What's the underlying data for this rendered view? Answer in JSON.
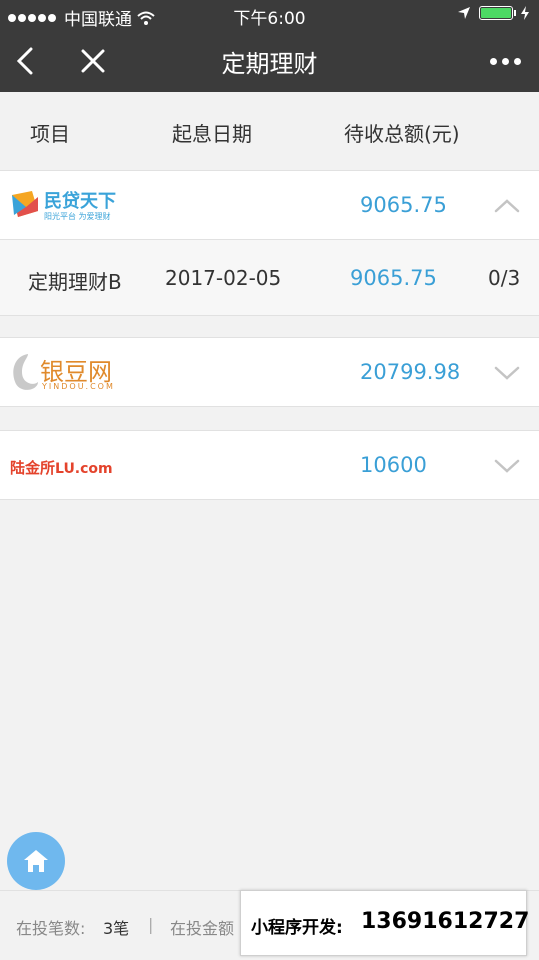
{
  "status_bar": {
    "carrier": "中国联通",
    "time": "下午6:00"
  },
  "nav": {
    "title": "定期理财"
  },
  "table_header": {
    "col1": "项目",
    "col2": "起息日期",
    "col3": "待收总额(元)"
  },
  "platforms": [
    {
      "logo_main": "民贷天下",
      "logo_sub": "阳光平台  为爱理财",
      "amount": "9065.75",
      "expanded": true
    },
    {
      "logo_main": "银豆网",
      "logo_sub": "YINDOU.COM",
      "amount": "20799.98",
      "expanded": false
    },
    {
      "logo_main": "陆金所",
      "logo_suffix": "LU.com",
      "amount": "10600",
      "expanded": false
    }
  ],
  "detail_row": {
    "name": "定期理财B",
    "date": "2017-02-05",
    "amount": "9065.75",
    "progress": "0/3"
  },
  "footer": {
    "count_label": "在投笔数:",
    "count_value": "3笔",
    "separator": "|",
    "amount_label": "在投金额"
  },
  "promo": {
    "label": "小程序开发:",
    "phone": "13691612727"
  },
  "colors": {
    "nav_bg": "#3b3b3b",
    "amount": "#3a9fd6",
    "fab": "#6fb8ee"
  }
}
